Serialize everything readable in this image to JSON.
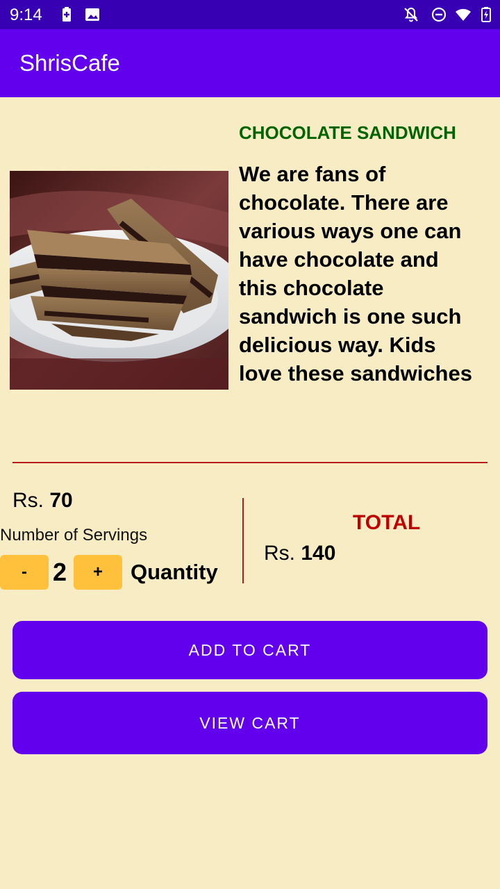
{
  "status_bar": {
    "time": "9:14",
    "icons": [
      "battery-plus-icon",
      "image-icon",
      "notifications-off-icon",
      "do-not-disturb-icon",
      "wifi-icon",
      "battery-charging-icon"
    ]
  },
  "app_bar": {
    "title": "ShrisCafe"
  },
  "product": {
    "name": "CHOCOLATE SANDWICH",
    "description": "We are fans of chocolate. There are various ways one can have chocolate and this chocolate sandwich is one such delicious way. Kids love these sandwiches",
    "price_prefix": "Rs.",
    "price_value": "70"
  },
  "servings": {
    "label": "Number of Servings",
    "minus_label": "-",
    "plus_label": "+",
    "quantity": "2",
    "quantity_label": "Quantity"
  },
  "total": {
    "label": "TOTAL",
    "prefix": "Rs.",
    "value": "140"
  },
  "actions": {
    "add_to_cart": "ADD TO CART",
    "view_cart": "VIEW CART"
  },
  "colors": {
    "status_bar": "#3700B3",
    "app_bar": "#6200EE",
    "background": "#F7ECC4",
    "name_green": "#006400",
    "total_red": "#C00000",
    "button_amber": "#FFC03B"
  }
}
